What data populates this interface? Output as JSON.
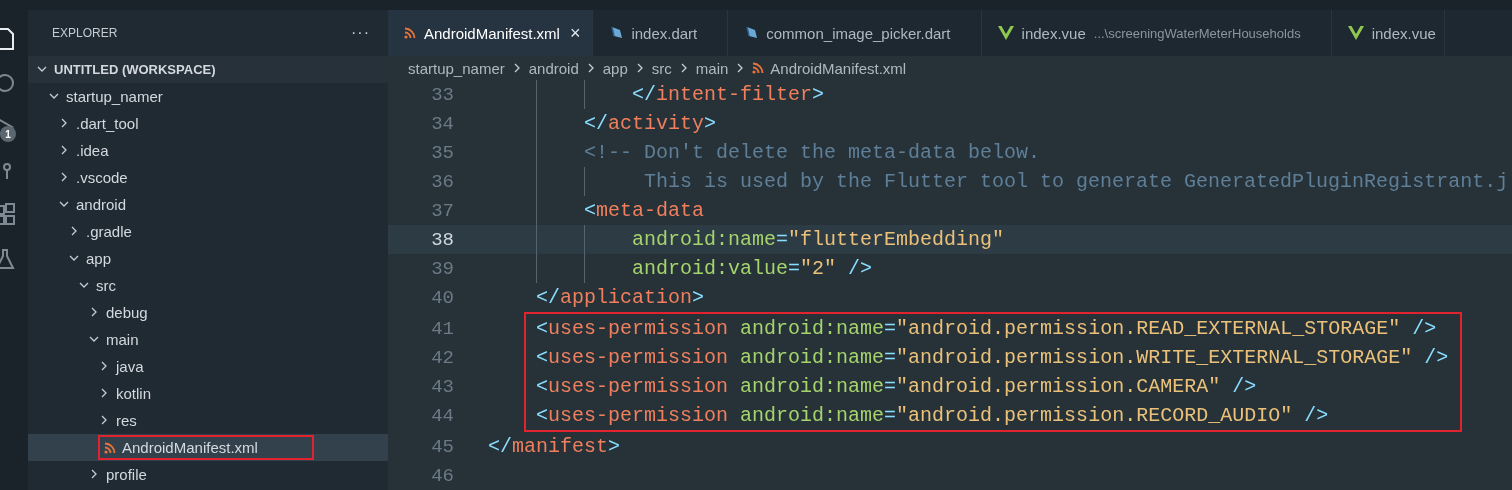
{
  "activity_bar": [
    {
      "kind": "files",
      "selected": true
    },
    {
      "kind": "search",
      "selected": false
    },
    {
      "kind": "debug",
      "selected": false,
      "badge": "1"
    },
    {
      "kind": "source",
      "selected": false
    },
    {
      "kind": "extensions",
      "selected": false
    },
    {
      "kind": "test",
      "selected": false
    }
  ],
  "sidebar": {
    "title": "EXPLORER",
    "more": "···",
    "workspace": {
      "label": "UNTITLED (WORKSPACE)",
      "expanded": true,
      "children": [
        {
          "label": "startup_namer",
          "expanded": true,
          "children": [
            {
              "label": ".dart_tool",
              "expanded": false
            },
            {
              "label": ".idea",
              "expanded": false
            },
            {
              "label": ".vscode",
              "expanded": false
            },
            {
              "label": "android",
              "expanded": true,
              "children": [
                {
                  "label": ".gradle",
                  "expanded": false
                },
                {
                  "label": "app",
                  "expanded": true,
                  "children": [
                    {
                      "label": "src",
                      "expanded": true,
                      "children": [
                        {
                          "label": "debug",
                          "expanded": false
                        },
                        {
                          "label": "main",
                          "expanded": true,
                          "children": [
                            {
                              "label": "java",
                              "expanded": false
                            },
                            {
                              "label": "kotlin",
                              "expanded": false
                            },
                            {
                              "label": "res",
                              "expanded": false
                            },
                            {
                              "label": "AndroidManifest.xml",
                              "kind": "xml",
                              "selected": true,
                              "highlighted": true
                            }
                          ]
                        },
                        {
                          "label": "profile",
                          "expanded": false
                        }
                      ]
                    }
                  ]
                }
              ]
            }
          ]
        }
      ]
    }
  },
  "tabs": [
    {
      "label": "AndroidManifest.xml",
      "kind": "xml",
      "selected": true,
      "close": "×"
    },
    {
      "label": "index.dart",
      "kind": "dart",
      "selected": false
    },
    {
      "label": "common_image_picker.dart",
      "kind": "dart",
      "selected": false
    },
    {
      "label": "index.vue",
      "kind": "vue",
      "selected": false,
      "description": "...\\screeningWaterMeterHouseholds"
    },
    {
      "label": "index.vue",
      "kind": "vue",
      "selected": false
    }
  ],
  "breadcrumb": [
    {
      "label": "startup_namer"
    },
    {
      "label": "android"
    },
    {
      "label": "app"
    },
    {
      "label": "src"
    },
    {
      "label": "main"
    },
    {
      "label": "AndroidManifest.xml",
      "kind": "xml"
    }
  ],
  "code": [
    {
      "children": [
        {
          "children": [
            {
              "children": [
                {
                  "number": "33",
                  "current": false,
                  "highlighted": false,
                  "tokens": [
                    {
                      "kind": "punct",
                      "text": "</"
                    },
                    {
                      "kind": "tag",
                      "text": "intent-filter"
                    },
                    {
                      "kind": "punct",
                      "text": ">"
                    }
                  ]
                }
              ]
            },
            {
              "number": "34",
              "current": false,
              "highlighted": false,
              "tokens": [
                {
                  "kind": "punct",
                  "text": "</"
                },
                {
                  "kind": "tag",
                  "text": "activity"
                },
                {
                  "kind": "punct",
                  "text": ">"
                }
              ]
            },
            {
              "number": "35",
              "current": false,
              "highlighted": false,
              "tokens": [
                {
                  "kind": "comment",
                  "text": "<!-- Don't delete the meta-data below."
                }
              ]
            },
            {
              "children": [
                {
                  "number": "36",
                  "current": false,
                  "highlighted": false,
                  "tokens": [
                    {
                      "kind": "comment",
                      "text": "This is used by the Flutter tool to generate GeneratedPluginRegistrant.j"
                    }
                  ]
                }
              ]
            },
            {
              "number": "37",
              "current": false,
              "highlighted": false,
              "tokens": [
                {
                  "kind": "punct",
                  "text": "<"
                },
                {
                  "kind": "tag",
                  "text": "meta-data"
                }
              ]
            },
            {
              "children": [
                {
                  "number": "38",
                  "current": true,
                  "highlighted": false,
                  "tokens": [
                    {
                      "kind": "attr",
                      "text": "android:name"
                    },
                    {
                      "kind": "punct",
                      "text": "="
                    },
                    {
                      "kind": "string",
                      "text": "\"flutterEmbedding\""
                    }
                  ]
                },
                {
                  "number": "39",
                  "current": false,
                  "highlighted": false,
                  "tokens": [
                    {
                      "kind": "attr",
                      "text": "android:value"
                    },
                    {
                      "kind": "punct",
                      "text": "="
                    },
                    {
                      "kind": "string",
                      "text": "\"2\""
                    },
                    {
                      "kind": "punct",
                      "text": " />"
                    }
                  ]
                }
              ]
            }
          ]
        },
        {
          "number": "40",
          "current": false,
          "highlighted": false,
          "tokens": [
            {
              "kind": "punct",
              "text": "</"
            },
            {
              "kind": "tag",
              "text": "application"
            },
            {
              "kind": "punct",
              "text": ">"
            }
          ]
        },
        {
          "number": "41",
          "current": false,
          "highlighted": true,
          "tokens": [
            {
              "kind": "punct",
              "text": "<"
            },
            {
              "kind": "tag",
              "text": "uses-permission"
            },
            {
              "kind": "attr",
              "text": " android:name"
            },
            {
              "kind": "punct",
              "text": "="
            },
            {
              "kind": "string",
              "text": "\"android.permission.READ_EXTERNAL_STORAGE\""
            },
            {
              "kind": "punct",
              "text": " />"
            }
          ]
        },
        {
          "number": "42",
          "current": false,
          "highlighted": true,
          "tokens": [
            {
              "kind": "punct",
              "text": "<"
            },
            {
              "kind": "tag",
              "text": "uses-permission"
            },
            {
              "kind": "attr",
              "text": " android:name"
            },
            {
              "kind": "punct",
              "text": "="
            },
            {
              "kind": "string",
              "text": "\"android.permission.WRITE_EXTERNAL_STORAGE\""
            },
            {
              "kind": "punct",
              "text": " />"
            }
          ]
        },
        {
          "number": "43",
          "current": false,
          "highlighted": true,
          "tokens": [
            {
              "kind": "punct",
              "text": "<"
            },
            {
              "kind": "tag",
              "text": "uses-permission"
            },
            {
              "kind": "attr",
              "text": " android:name"
            },
            {
              "kind": "punct",
              "text": "="
            },
            {
              "kind": "string",
              "text": "\"android.permission.CAMERA\""
            },
            {
              "kind": "punct",
              "text": " />"
            }
          ]
        },
        {
          "number": "44",
          "current": false,
          "highlighted": true,
          "tokens": [
            {
              "kind": "punct",
              "text": "<"
            },
            {
              "kind": "tag",
              "text": "uses-permission"
            },
            {
              "kind": "attr",
              "text": " android:name"
            },
            {
              "kind": "punct",
              "text": "="
            },
            {
              "kind": "string",
              "text": "\"android.permission.RECORD_AUDIO\""
            },
            {
              "kind": "punct",
              "text": " />"
            }
          ]
        }
      ]
    },
    {
      "number": "45",
      "current": false,
      "highlighted": false,
      "tokens": [
        {
          "kind": "punct",
          "text": "</"
        },
        {
          "kind": "tag",
          "text": "manifest"
        },
        {
          "kind": "punct",
          "text": ">"
        }
      ]
    },
    {
      "number": "46",
      "current": false,
      "highlighted": false
    }
  ]
}
